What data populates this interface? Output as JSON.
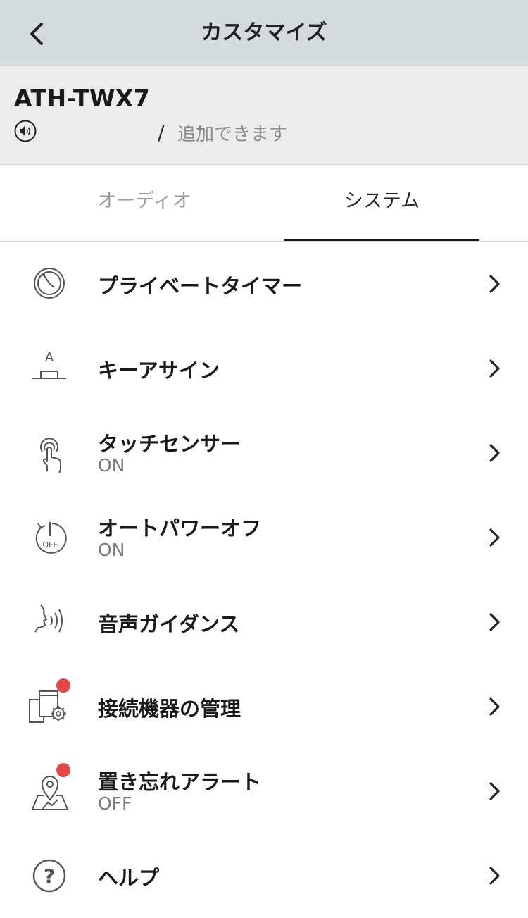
{
  "header": {
    "title": "カスタマイズ"
  },
  "device": {
    "name": "ATH-TWX7",
    "slash": "/",
    "addable_text": "追加できます"
  },
  "tabs": [
    {
      "label": "オーディオ",
      "selected": false
    },
    {
      "label": "システム",
      "selected": true
    }
  ],
  "menu": [
    {
      "label": "プライベートタイマー",
      "sub": "",
      "icon": "private-timer-icon"
    },
    {
      "label": "キーアサイン",
      "sub": "",
      "icon": "key-assign-icon"
    },
    {
      "label": "タッチセンサー",
      "sub": "ON",
      "icon": "touch-sensor-icon"
    },
    {
      "label": "オートパワーオフ",
      "sub": "ON",
      "icon": "auto-power-off-icon",
      "icon_text": "OFF"
    },
    {
      "label": "音声ガイダンス",
      "sub": "",
      "icon": "voice-guidance-icon"
    },
    {
      "label": "接続機器の管理",
      "sub": "",
      "icon": "connected-devices-icon",
      "badge": true
    },
    {
      "label": "置き忘れアラート",
      "sub": "OFF",
      "icon": "lost-alert-icon",
      "badge": true
    },
    {
      "label": "ヘルプ",
      "sub": "",
      "icon": "help-icon"
    }
  ],
  "icon_glyphs": {
    "key_assign_letter": "A",
    "help_mark": "?"
  },
  "colors": {
    "header_bg": "#d5dadb",
    "device_bar_bg": "#ececec",
    "badge": "#e04848",
    "tab_underline": "#1a1a1a"
  }
}
